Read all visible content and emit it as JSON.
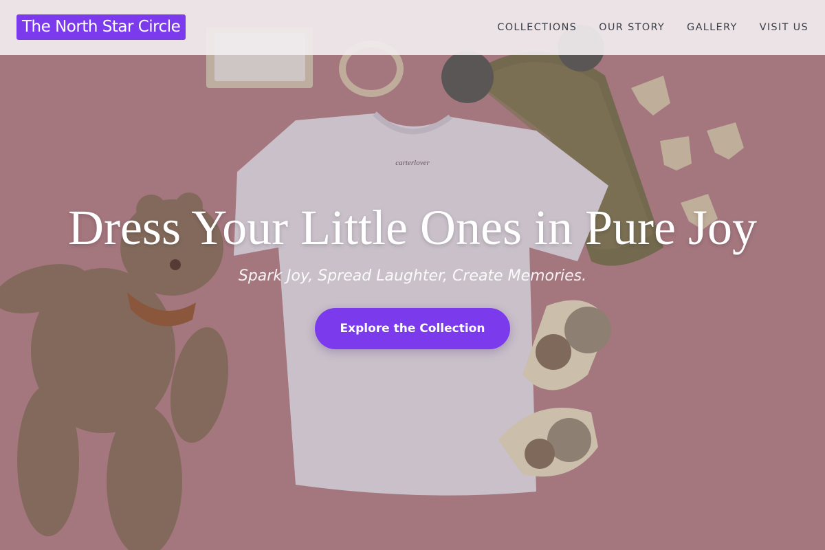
{
  "brand": {
    "name": "The North Star Circle",
    "color": "#7c3aed"
  },
  "nav": {
    "items": [
      {
        "label": "COLLECTIONS"
      },
      {
        "label": "OUR STORY"
      },
      {
        "label": "GALLERY"
      },
      {
        "label": "VISIT US"
      }
    ]
  },
  "hero": {
    "title": "Dress Your Little Ones in Pure Joy",
    "tagline": "Spark Joy, Spread Laughter, Create Memories.",
    "cta_label": "Explore the Collection",
    "background_color": "#b9848a",
    "tshirt_tag_text": "carterlover"
  }
}
